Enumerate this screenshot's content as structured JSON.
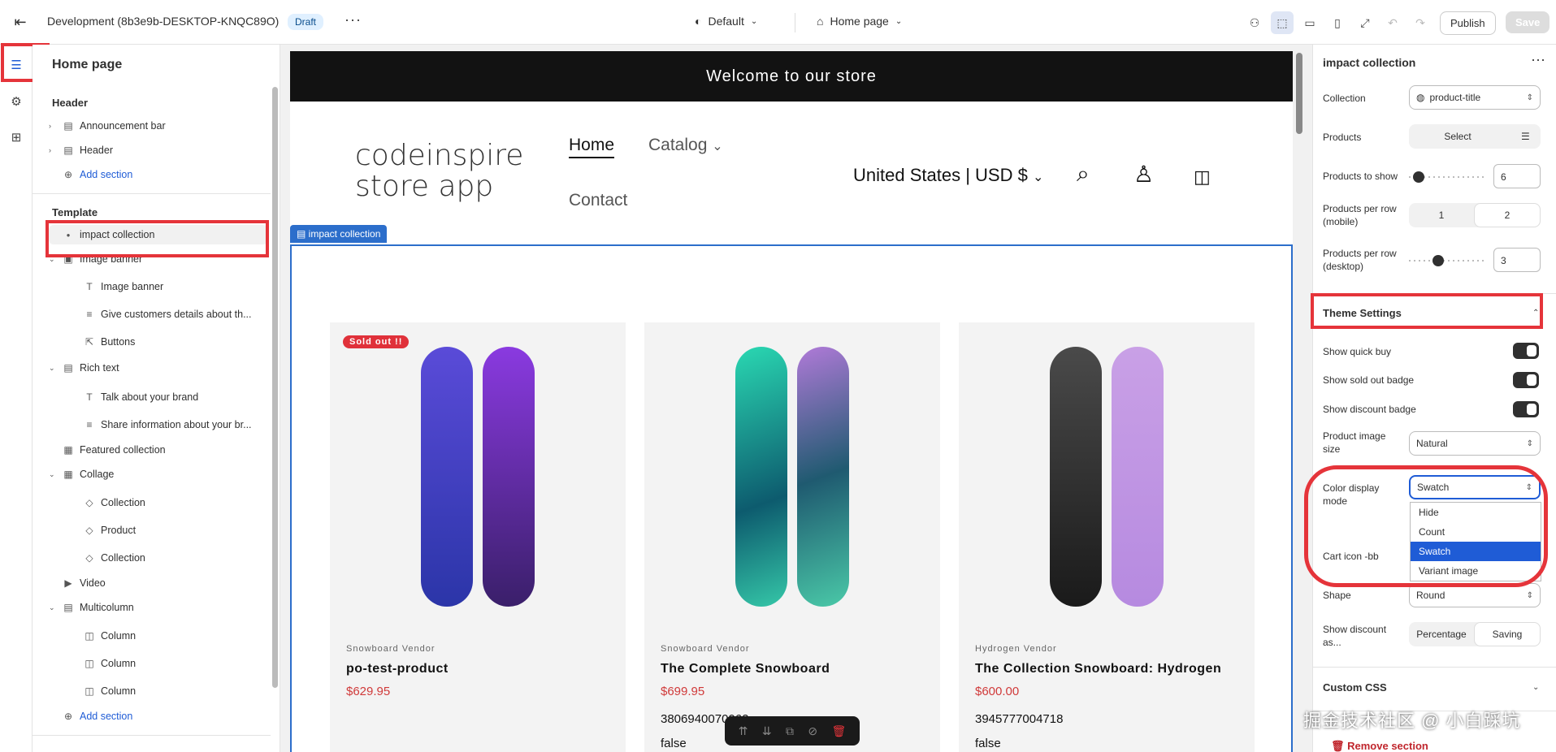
{
  "topbar": {
    "store_title": "Development (8b3e9b-DESKTOP-KNQC89O)",
    "badge": "Draft",
    "more": "···",
    "theme": "Default",
    "page": "Home page",
    "publish": "Publish",
    "save": "Save"
  },
  "sidebar": {
    "title": "Home page",
    "header_group": "Header",
    "header_items": [
      "Announcement bar",
      "Header"
    ],
    "add_section": "Add section",
    "template_group": "Template",
    "template_items": [
      {
        "label": "impact collection"
      },
      {
        "label": "Image banner"
      },
      {
        "label": "Image banner"
      },
      {
        "label": "Give customers details about th..."
      },
      {
        "label": "Buttons"
      },
      {
        "label": "Rich text"
      },
      {
        "label": "Talk about your brand"
      },
      {
        "label": "Share information about your br..."
      },
      {
        "label": "Featured collection"
      },
      {
        "label": "Collage"
      },
      {
        "label": "Collection"
      },
      {
        "label": "Product"
      },
      {
        "label": "Collection"
      },
      {
        "label": "Video"
      },
      {
        "label": "Multicolumn"
      },
      {
        "label": "Column"
      },
      {
        "label": "Column"
      },
      {
        "label": "Column"
      }
    ],
    "add_section_2": "Add section"
  },
  "store": {
    "announcement": "Welcome to our store",
    "logo_line1": "codeinspire",
    "logo_line2": "store app",
    "nav": {
      "home": "Home",
      "catalog": "Catalog",
      "contact": "Contact"
    },
    "currency": "United States | USD $",
    "section_tag": "impact collection",
    "products": [
      {
        "badge": "Sold out !!",
        "vendor": "Snowboard Vendor",
        "name": "po-test-product",
        "price": "$629.95",
        "extra1": "",
        "extra2": ""
      },
      {
        "badge": "",
        "vendor": "Snowboard Vendor",
        "name": "The Complete Snowboard",
        "price": "$699.95",
        "extra1": "3806940070062",
        "extra2": "false"
      },
      {
        "badge": "",
        "vendor": "Hydrogen Vendor",
        "name": "The Collection Snowboard: Hydrogen",
        "price": "$600.00",
        "extra1": "3945777004718",
        "extra2": "false"
      }
    ]
  },
  "settings": {
    "title": "impact collection",
    "collection_label": "Collection",
    "collection_value": "product-title",
    "products_label": "Products",
    "products_btn": "Select",
    "to_show_label": "Products to show",
    "to_show_value": "6",
    "to_show_level": 0.05,
    "per_row_mobile_label": "Products per row (mobile)",
    "per_row_mobile_options": [
      "1",
      "2"
    ],
    "per_row_desktop_label": "Products per row (desktop)",
    "per_row_desktop_value": "3",
    "per_row_desktop_level": 0.3,
    "theme_settings": "Theme Settings",
    "show_quick_buy": "Show quick buy",
    "show_sold_out": "Show sold out badge",
    "show_discount": "Show discount badge",
    "image_size_label": "Product image size",
    "image_size_value": "Natural",
    "color_mode_label": "Color display mode",
    "color_mode_value": "Swatch",
    "color_mode_options": [
      "Hide",
      "Count",
      "Swatch",
      "Variant image"
    ],
    "cart_icon_label": "Cart icon -bb",
    "shape_label": "Shape",
    "shape_value": "Round",
    "show_discount_as_label": "Show discount as...",
    "show_discount_as_options": [
      "Percentage",
      "Saving"
    ],
    "custom_css": "Custom CSS",
    "remove_section": "Remove section"
  },
  "watermark": "掘金技术社区 @ 小白踩坑",
  "colors": {
    "accent": "#2c6ecb",
    "annotation": "#e5343a",
    "sale": "#d03a3a"
  }
}
